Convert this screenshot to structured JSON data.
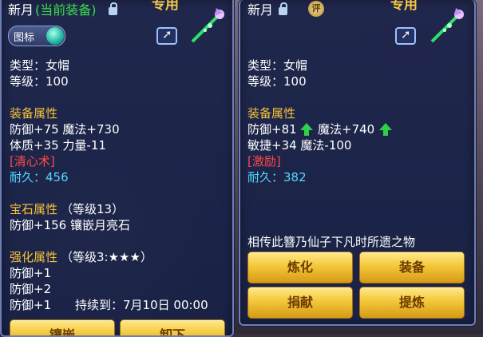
{
  "left": {
    "title": "新月",
    "title_status": "(当前装备)",
    "exclusive": "专用",
    "toggle_label": "图标",
    "type": "类型：女帽",
    "level": "等级：100",
    "equip_attr_heading": "装备属性",
    "attr_line1": "防御+75 魔法+730",
    "attr_line2": "体质+35 力量-11",
    "special_skill": "[清心术]",
    "durability": "耐久：456",
    "gem_heading": "宝石属性",
    "gem_level": "（等级13）",
    "gem_line": "防御+156 镶嵌月亮石",
    "enhance_heading": "强化属性",
    "enhance_level": "（等级3:★★★）",
    "enhance1": "防御+1",
    "enhance2": "防御+2",
    "enhance3": "防御+1",
    "enhance_duration": "持续到：7月10日 00:00",
    "btn_inlay": "镶嵌",
    "btn_remove": "卸下"
  },
  "right": {
    "title": "新月",
    "badge": "评",
    "exclusive": "专用",
    "type": "类型：女帽",
    "level": "等级：100",
    "equip_attr_heading": "装备属性",
    "attr_def": "防御+81",
    "attr_mag": "魔法+740",
    "attr_line2": "敏捷+34 魔法-100",
    "special_skill": "[激励]",
    "durability": "耐久：382",
    "description": "相传此簪乃仙子下凡时所遗之物",
    "btn_refine": "炼化",
    "btn_equip": "装备",
    "btn_donate": "捐献",
    "btn_extract": "提炼"
  },
  "colors": {
    "panel_bg": "#18224a",
    "heading": "#f5c23a",
    "current": "#3cdc4a",
    "durability": "#56d8ff",
    "skill": "#ff4848",
    "button": "#f3c73a"
  },
  "icons": [
    "lock-icon",
    "share-icon",
    "wand-icon",
    "arrow-up-icon",
    "rating-badge-icon"
  ]
}
